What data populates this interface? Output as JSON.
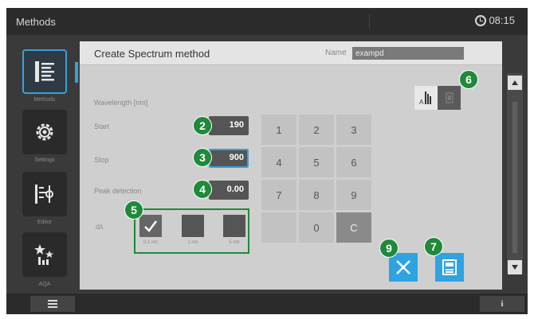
{
  "topbar": {
    "title": "Methods",
    "time": "08:15"
  },
  "sidebar": {
    "items": [
      {
        "label": "Methods",
        "icon": "methods-list-icon"
      },
      {
        "label": "Settings",
        "icon": "gear-icon"
      },
      {
        "label": "Editor",
        "icon": "editor-icon"
      },
      {
        "label": "AQA",
        "icon": "aqa-icon"
      }
    ]
  },
  "panel": {
    "title": "Create Spectrum method",
    "name_label": "Name",
    "name_value": "exampd",
    "section_label": "Wavelength [nm]",
    "fields": {
      "start_label": "Start",
      "start_value": "190",
      "stop_label": "Stop",
      "stop_value": "900",
      "peak_label": "Peak detection",
      "peak_value": "0.00"
    },
    "dx_label": "dλ",
    "dx_options": [
      {
        "label": "0.1 nm",
        "checked": true
      },
      {
        "label": "1 nm",
        "checked": false
      },
      {
        "label": "5 nm",
        "checked": false
      }
    ],
    "keypad": [
      "1",
      "2",
      "3",
      "4",
      "5",
      "6",
      "7",
      "8",
      "9",
      "",
      "0",
      "C"
    ]
  },
  "badges": {
    "b2": "2",
    "b3": "3",
    "b4": "4",
    "b5": "5",
    "b6": "6",
    "b7": "7",
    "b9": "9"
  },
  "colors": {
    "accent": "#2fa3e0",
    "badge": "#1e8a3a",
    "panel": "#cfcfcf"
  }
}
